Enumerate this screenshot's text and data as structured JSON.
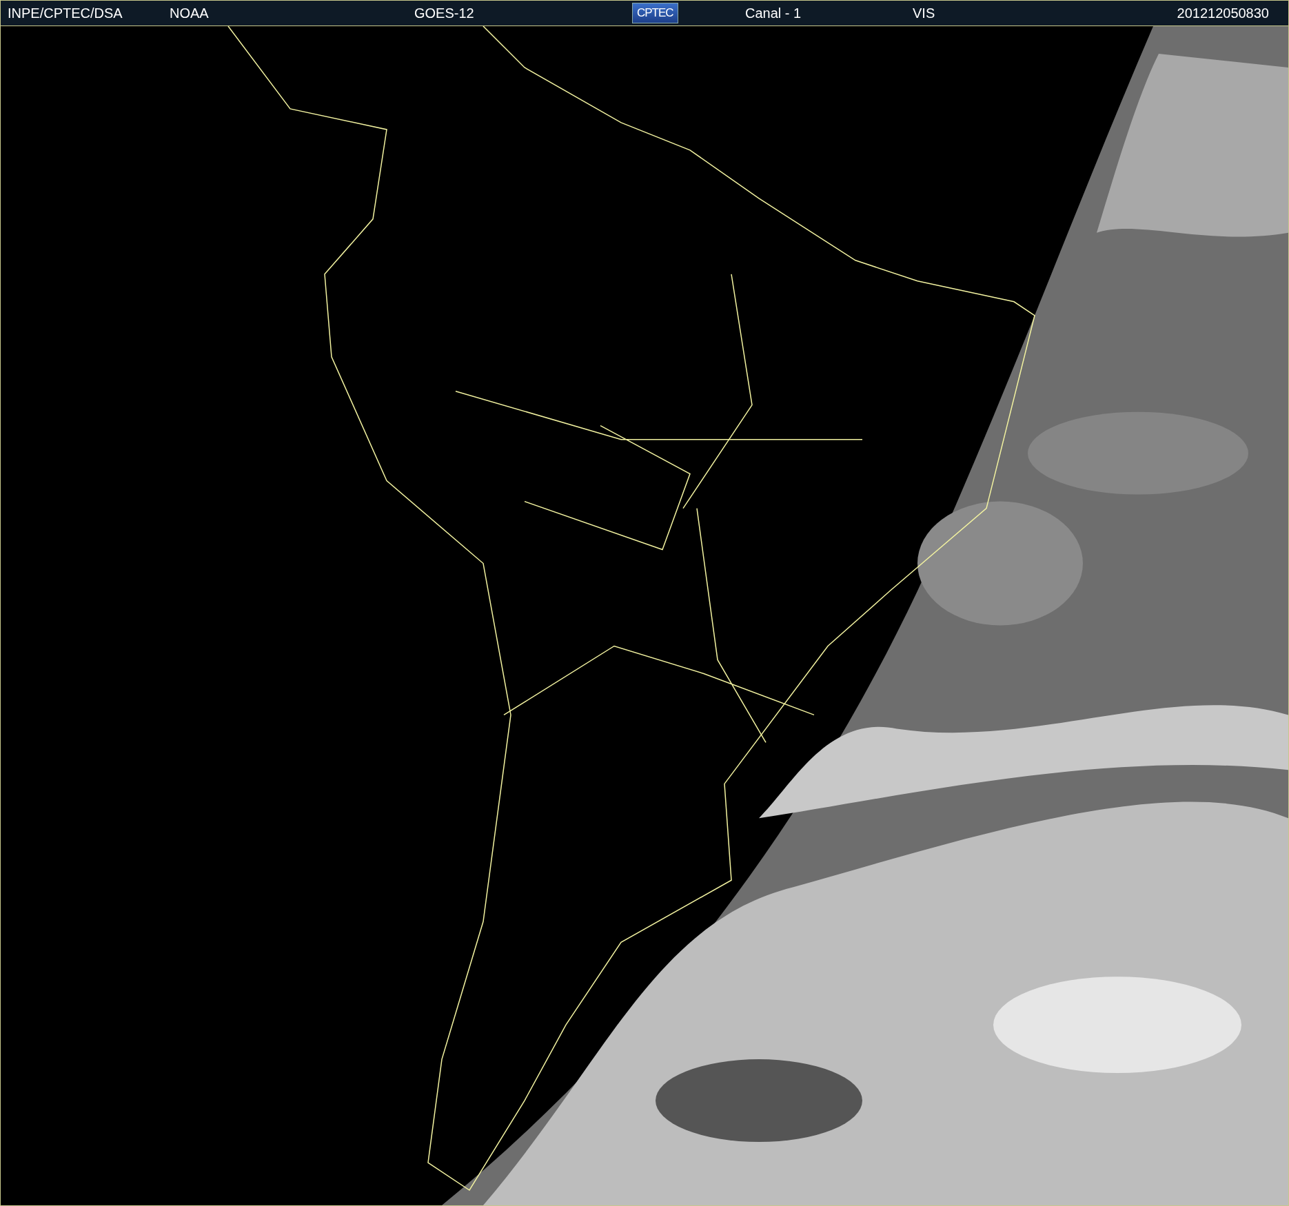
{
  "header": {
    "items": [
      {
        "kind": "text",
        "text": "INPE/CPTEC/DSA"
      },
      {
        "kind": "text",
        "text": "NOAA"
      },
      {
        "kind": "text",
        "text": "GOES-12"
      },
      {
        "kind": "logo",
        "text": "CPTEC"
      },
      {
        "kind": "text",
        "text": "Canal - 1"
      },
      {
        "kind": "text",
        "text": "VIS"
      },
      {
        "kind": "text",
        "text": "201212050830"
      }
    ]
  }
}
